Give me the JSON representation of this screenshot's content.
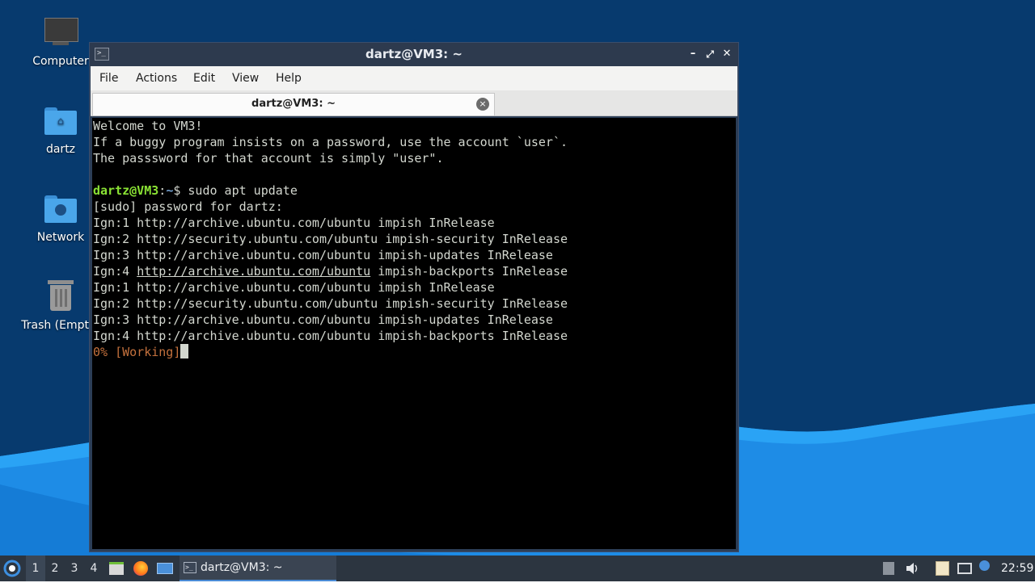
{
  "desktop": {
    "icons": [
      {
        "label": "Computer",
        "icon": "computer-icon"
      },
      {
        "label": "dartz",
        "icon": "home-folder-icon"
      },
      {
        "label": "Network",
        "icon": "network-folder-icon"
      },
      {
        "label": "Trash (Empty)",
        "icon": "trash-icon"
      }
    ],
    "colors": {
      "background": "#073a6e",
      "wave": "#1e8ce6"
    }
  },
  "window": {
    "title": "dartz@VM3: ~",
    "buttons": {
      "minimize": "–",
      "maximize": "⤢",
      "close": "✕"
    },
    "menu": [
      "File",
      "Actions",
      "Edit",
      "View",
      "Help"
    ],
    "tab": {
      "label": "dartz@VM3: ~",
      "close": "×"
    }
  },
  "terminal": {
    "welcome": [
      "Welcome to VM3!",
      "If a buggy program insists on a password, use the account `user`.",
      "The passsword for that account is simply \"user\"."
    ],
    "prompt": {
      "user_host": "dartz@VM3",
      "sep": ":",
      "path": "~",
      "dollar": "$ ",
      "command": "sudo apt update"
    },
    "sudo_prompt": "[sudo] password for dartz:",
    "output": [
      "Ign:1 http://archive.ubuntu.com/ubuntu impish InRelease",
      "Ign:2 http://security.ubuntu.com/ubuntu impish-security InRelease",
      "Ign:3 http://archive.ubuntu.com/ubuntu impish-updates InRelease",
      {
        "prefix": "Ign:4 ",
        "link": "http://archive.ubuntu.com/ubuntu",
        "suffix": " impish-backports InRelease"
      },
      "Ign:1 http://archive.ubuntu.com/ubuntu impish InRelease",
      "Ign:2 http://security.ubuntu.com/ubuntu impish-security InRelease",
      "Ign:3 http://archive.ubuntu.com/ubuntu impish-updates InRelease",
      "Ign:4 http://archive.ubuntu.com/ubuntu impish-backports InRelease"
    ],
    "progress": "0% [Working]"
  },
  "taskbar": {
    "workspaces": [
      "1",
      "2",
      "3",
      "4"
    ],
    "active_workspace": "1",
    "task_label": "dartz@VM3: ~",
    "clock": "22:59"
  }
}
